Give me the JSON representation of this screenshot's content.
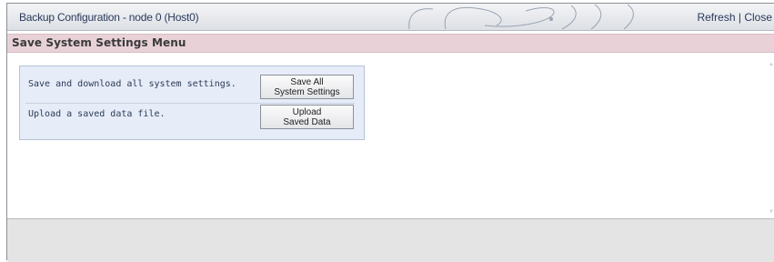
{
  "window": {
    "title": "Backup Configuration - node 0 (Host0)",
    "actions": {
      "refresh": "Refresh",
      "separator": "|",
      "close": "Close"
    }
  },
  "menu": {
    "heading": "Save System Settings Menu"
  },
  "panel": {
    "rows": [
      {
        "description": "Save and download all system settings.",
        "button_line1": "Save All",
        "button_line2": "System Settings"
      },
      {
        "description": "Upload a saved data file.",
        "button_line1": "Upload",
        "button_line2": "Saved Data"
      }
    ]
  },
  "colors": {
    "title_text": "#2a3a5c",
    "menu_band": "#e8d2d8",
    "panel_bg": "#e6ecf8",
    "footer_bg": "#e4e4e4"
  }
}
